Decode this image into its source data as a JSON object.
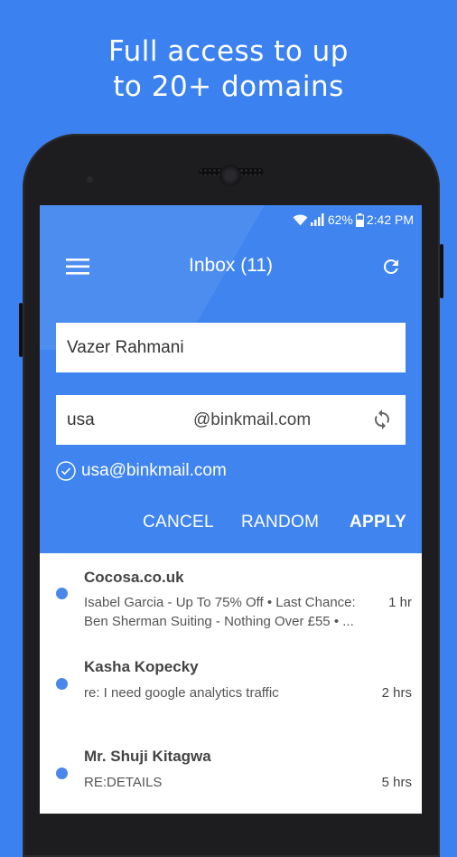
{
  "headline": {
    "line1": "Full access to up",
    "line2": "to 20+ domains"
  },
  "status_bar": {
    "battery_percent": "62%",
    "time": "2:42 PM"
  },
  "toolbar": {
    "title": "Inbox (11)",
    "menu_icon": "hamburger-menu-icon",
    "refresh_icon": "refresh-icon"
  },
  "form": {
    "name_value": "Vazer Rahmani",
    "username_value": "usa",
    "domain": "@binkmail.com",
    "verified_address": "usa@binkmail.com",
    "cancel_label": "CANCEL",
    "random_label": "RANDOM",
    "apply_label": "APPLY"
  },
  "messages": [
    {
      "sender": "Cocosa.co.uk",
      "preview_line1": "Isabel Garcia - Up To 75% Off • Last Chance:",
      "preview_line2": "Ben Sherman Suiting - Nothing Over £55 • ...",
      "time": "1 hr",
      "unread": true
    },
    {
      "sender": "Kasha Kopecky",
      "preview_line1": "re: I need google analytics traffic",
      "preview_line2": "",
      "time": "2 hrs",
      "unread": true
    },
    {
      "sender": "Mr. Shuji Kitagwa",
      "preview_line1": "RE:DETAILS",
      "preview_line2": "",
      "time": "5 hrs",
      "unread": true
    }
  ],
  "colors": {
    "background": "#3b82f0",
    "appbar": "#3f84ef",
    "unread_dot": "#4a87ea",
    "phone_body": "#1d1d1f"
  }
}
